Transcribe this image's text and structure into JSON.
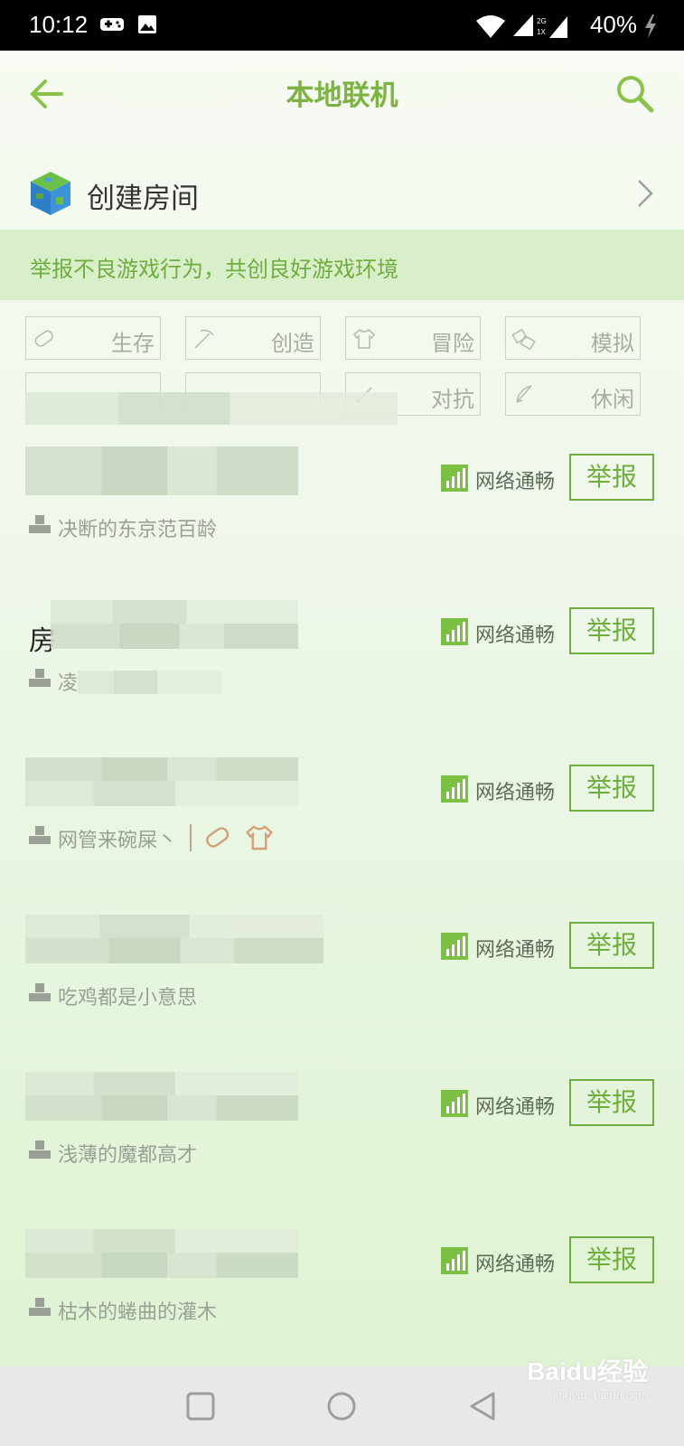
{
  "status_bar": {
    "time": "10:12",
    "battery": "40%"
  },
  "header": {
    "title": "本地联机"
  },
  "create_room": {
    "label": "创建房间"
  },
  "notice": {
    "text": "举报不良游戏行为，共创良好游戏环境"
  },
  "tags": [
    {
      "label": "生存",
      "icon": "bread-icon"
    },
    {
      "label": "创造",
      "icon": "pickaxe-icon"
    },
    {
      "label": "冒险",
      "icon": "shirt-icon"
    },
    {
      "label": "模拟",
      "icon": "blocks-icon"
    },
    {
      "label": "对抗",
      "icon": "sword-icon"
    },
    {
      "label": "休闲",
      "icon": "bow-icon"
    }
  ],
  "rooms": [
    {
      "owner": "决断的东京范百龄",
      "status": "网络通畅",
      "report": "举报"
    },
    {
      "title_prefix": "房",
      "owner": "凌",
      "status": "网络通畅",
      "report": "举报"
    },
    {
      "owner": "网管来碗屎丶",
      "status": "网络通畅",
      "report": "举报"
    },
    {
      "owner": "吃鸡都是小意思",
      "status": "网络通畅",
      "report": "举报"
    },
    {
      "owner": "浅薄的魔都高才",
      "status": "网络通畅",
      "report": "举报"
    },
    {
      "owner": "枯木的蜷曲的灌木",
      "status": "网络通畅",
      "report": "举报"
    }
  ],
  "watermark": {
    "brand": "Baidu经验",
    "url": "jingyan.baidu.com"
  },
  "colors": {
    "accent": "#7cb342",
    "notice_bg": "#d8efc9"
  }
}
